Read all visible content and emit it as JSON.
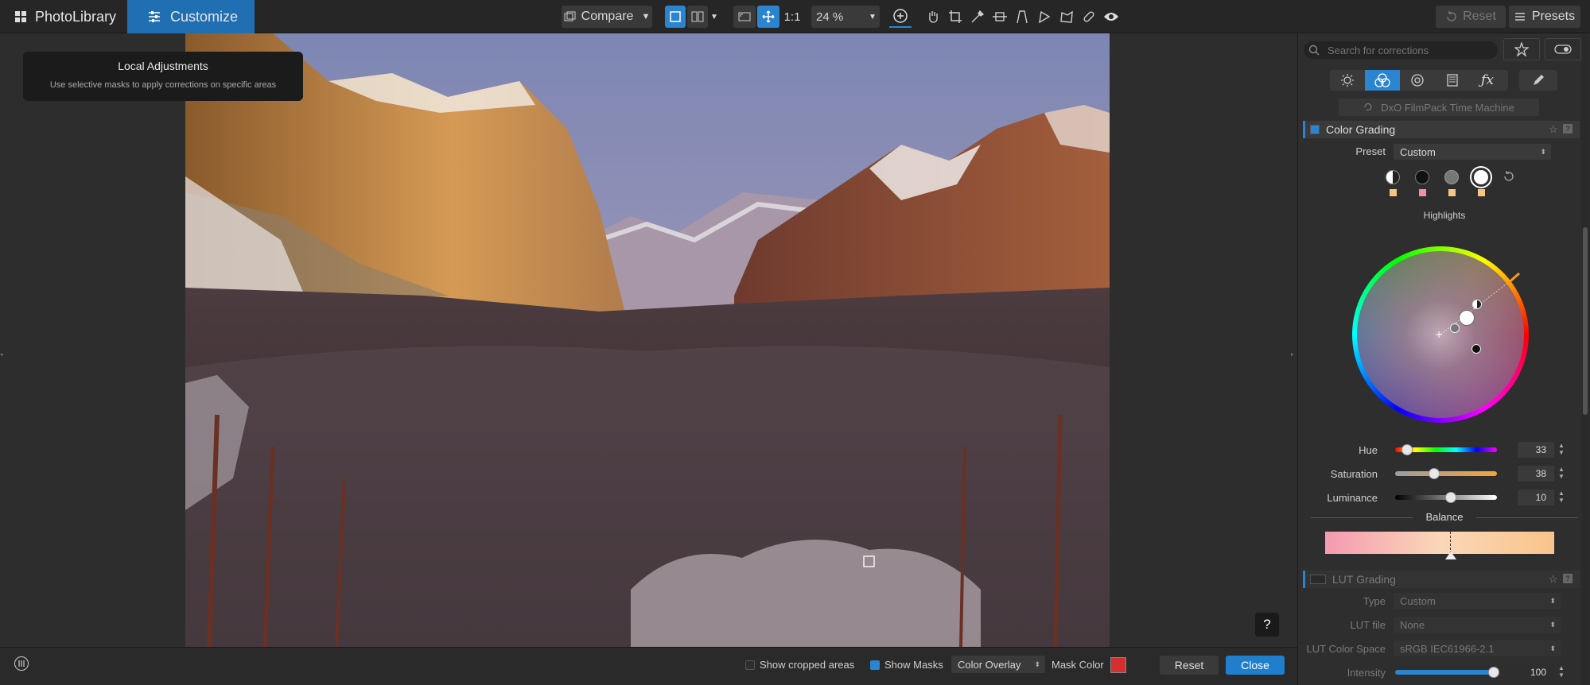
{
  "topbar": {
    "tab_photolibrary": "PhotoLibrary",
    "tab_customize": "Customize",
    "compare_label": "Compare",
    "one_to_one": "1:1",
    "zoom_value": "24 %",
    "reset_label": "Reset",
    "presets_label": "Presets"
  },
  "viewer": {
    "tooltip_title": "Local Adjustments",
    "tooltip_text": "Use selective masks to apply corrections on specific areas",
    "help_label": "?"
  },
  "bottombar": {
    "show_cropped": "Show cropped areas",
    "show_masks": "Show Masks",
    "overlay_mode": "Color Overlay",
    "mask_color_label": "Mask Color",
    "reset_label": "Reset",
    "close_label": "Close",
    "mask_color": "#d32f2f"
  },
  "panel": {
    "search_placeholder": "Search for corrections",
    "filmpack_label": "DxO FilmPack Time Machine",
    "color_grading": {
      "title": "Color Grading",
      "preset_label": "Preset",
      "preset_value": "Custom",
      "selected_tone": "Highlights",
      "hue_label": "Hue",
      "hue_value": "33",
      "hue_fraction": 0.12,
      "saturation_label": "Saturation",
      "saturation_value": "38",
      "saturation_fraction": 0.38,
      "luminance_label": "Luminance",
      "luminance_value": "10",
      "luminance_fraction": 0.55,
      "balance_label": "Balance"
    },
    "lut_grading": {
      "title": "LUT Grading",
      "type_label": "Type",
      "type_value": "Custom",
      "lut_file_label": "LUT file",
      "lut_file_value": "None",
      "color_space_label": "LUT Color Space",
      "color_space_value": "sRGB IEC61966-2.1",
      "intensity_label": "Intensity",
      "intensity_value": "100"
    }
  },
  "colors": {
    "accent": "#2b84d0",
    "customize_tab": "#1f6fb2"
  }
}
